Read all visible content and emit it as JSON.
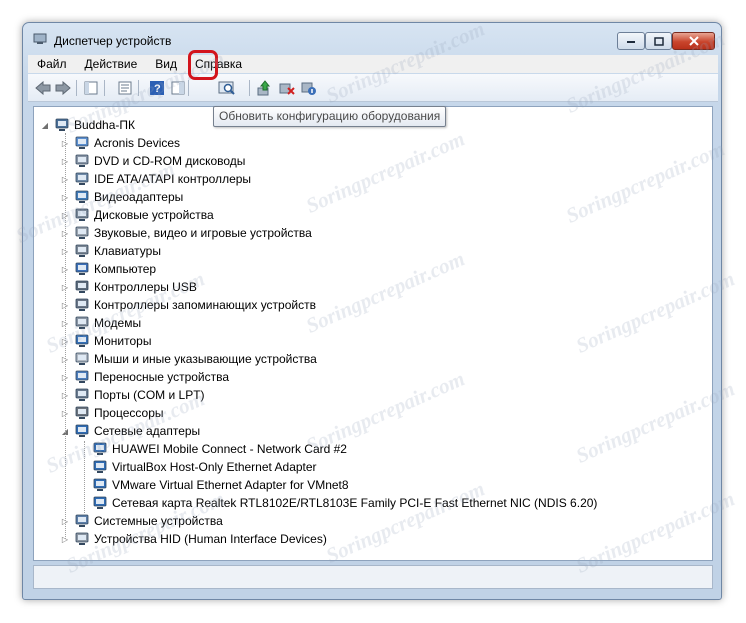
{
  "window": {
    "title": "Диспетчер устройств"
  },
  "menu": [
    "Файл",
    "Действие",
    "Вид",
    "Справка"
  ],
  "tooltip": "Обновить конфигурацию оборудования",
  "tree": {
    "root": "Buddha-ПК",
    "categories": [
      {
        "label": "Acronis Devices",
        "icon": "devices-icon"
      },
      {
        "label": "DVD и CD-ROM дисководы",
        "icon": "dvd-drive-icon"
      },
      {
        "label": "IDE ATA/ATAPI контроллеры",
        "icon": "ide-controller-icon"
      },
      {
        "label": "Видеоадаптеры",
        "icon": "display-adapter-icon"
      },
      {
        "label": "Дисковые устройства",
        "icon": "disk-drive-icon"
      },
      {
        "label": "Звуковые, видео и игровые устройства",
        "icon": "sound-icon"
      },
      {
        "label": "Клавиатуры",
        "icon": "keyboard-icon"
      },
      {
        "label": "Компьютер",
        "icon": "computer-icon"
      },
      {
        "label": "Контроллеры USB",
        "icon": "usb-icon"
      },
      {
        "label": "Контроллеры запоминающих устройств",
        "icon": "storage-controller-icon"
      },
      {
        "label": "Модемы",
        "icon": "modem-icon"
      },
      {
        "label": "Мониторы",
        "icon": "monitor-icon"
      },
      {
        "label": "Мыши и иные указывающие устройства",
        "icon": "mouse-icon"
      },
      {
        "label": "Переносные устройства",
        "icon": "portable-device-icon"
      },
      {
        "label": "Порты (COM и LPT)",
        "icon": "port-icon"
      },
      {
        "label": "Процессоры",
        "icon": "processor-icon"
      },
      {
        "label": "Сетевые адаптеры",
        "icon": "network-adapter-icon"
      },
      {
        "label": "Системные устройства",
        "icon": "system-device-icon"
      },
      {
        "label": "Устройства HID (Human Interface Devices)",
        "icon": "hid-icon"
      }
    ],
    "network_children": [
      "HUAWEI Mobile Connect - Network Card #2",
      "VirtualBox Host-Only Ethernet Adapter",
      "VMware Virtual Ethernet Adapter for VMnet8",
      "Сетевая карта Realtek RTL8102E/RTL8103E Family PCI-E Fast Ethernet NIC (NDIS 6.20)"
    ]
  },
  "watermark": "Soringpcrepair.com",
  "colors": {
    "highlight": "#d3141c",
    "titlebar": "#c6d7ea"
  }
}
